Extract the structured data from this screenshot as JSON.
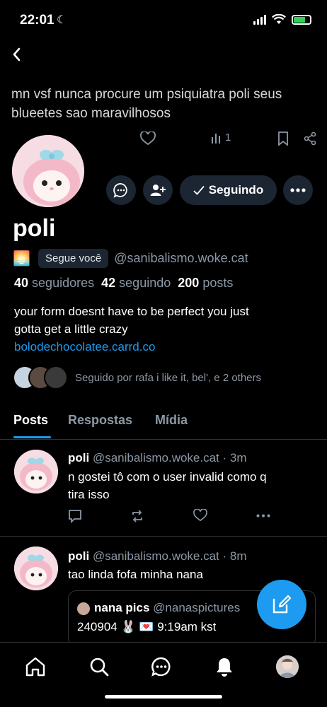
{
  "status_bar": {
    "time": "22:01"
  },
  "prev_post": {
    "text_line1": "mn vsf nunca procure um psiquiatra poli  seus",
    "text_line2": "blueetes sao maravilhosos",
    "views": "1"
  },
  "profile": {
    "display_name": "poli",
    "follows_you_badge": "Segue você",
    "handle": "@sanibalismo.woke.cat",
    "followers_count": "40",
    "followers_label": "seguidores",
    "following_count": "42",
    "following_label": "seguindo",
    "posts_count": "200",
    "posts_label": "posts",
    "bio_line1": "your form doesnt have to be perfect you just",
    "bio_line2": "gotta get a little crazy",
    "link": "bolodechocolatee.carrd.co",
    "followed_by": "Seguido por rafa i like it, bel', e 2 others",
    "follow_button": "Seguindo"
  },
  "tabs": [
    {
      "label": "Posts",
      "active": true
    },
    {
      "label": "Respostas",
      "active": false
    },
    {
      "label": "Mídia",
      "active": false
    }
  ],
  "posts": [
    {
      "author": "poli",
      "handle": "@sanibalismo.woke.cat",
      "time": "3m",
      "text_line1": "n gostei tô com o user invalid como q",
      "text_line2": "tira isso"
    },
    {
      "author": "poli",
      "handle": "@sanibalismo.woke.cat",
      "time": "8m",
      "text_line1": "tao linda fofa minha nana"
    }
  ],
  "quote": {
    "author": "nana pics",
    "handle": "@nanaspictures",
    "text": "240904 🐰 💌 9:19am kst"
  },
  "colors": {
    "accent": "#1d9bf0",
    "background": "#000000",
    "muted": "#8b98a5",
    "pill": "#1c2532"
  },
  "icons": [
    "back-arrow-icon",
    "reply-icon",
    "repost-icon",
    "like-icon",
    "views-icon",
    "bookmark-icon",
    "share-icon",
    "message-icon",
    "add-user-icon",
    "more-icon",
    "compose-icon",
    "home-icon",
    "search-icon",
    "chat-icon",
    "notifications-icon"
  ]
}
